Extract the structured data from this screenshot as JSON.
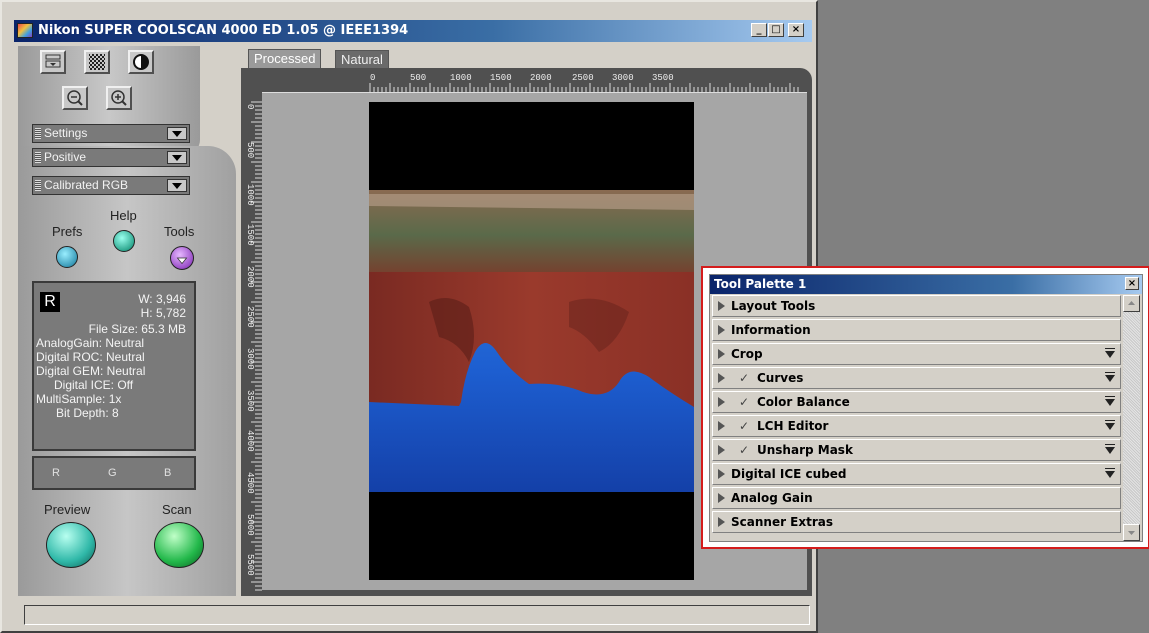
{
  "window": {
    "title": "Nikon SUPER COOLSCAN 4000 ED 1.05 @ IEEE1394",
    "minimize": "_",
    "maximize": "□",
    "close": "×"
  },
  "left_panel": {
    "dropdowns": [
      {
        "selected": "Settings"
      },
      {
        "selected": "Positive"
      },
      {
        "selected": "Calibrated RGB"
      }
    ],
    "buttons": {
      "prefs": "Prefs",
      "help": "Help",
      "tools": "Tools",
      "preview": "Preview",
      "scan": "Scan"
    },
    "info": {
      "channel_badge": "R",
      "width": "W: 3,946",
      "height": "H: 5,782",
      "file_size": "File Size: 65.3 MB",
      "analog_gain": "AnalogGain: Neutral",
      "digital_roc": "Digital ROC: Neutral",
      "digital_gem": "Digital GEM: Neutral",
      "digital_ice": "Digital ICE: Off",
      "multisample": "MultiSample: 1x",
      "bit_depth": "Bit Depth: 8"
    },
    "rgb_readout": {
      "r": "R",
      "g": "G",
      "b": "B"
    }
  },
  "preview": {
    "tabs": [
      {
        "label": "Processed",
        "active": true
      },
      {
        "label": "Natural",
        "active": false
      }
    ],
    "h_ruler": [
      "0",
      "500",
      "1000",
      "1500",
      "2000",
      "2500",
      "3000",
      "3500"
    ],
    "v_ruler": [
      "0",
      "500",
      "1000",
      "1500",
      "2000",
      "2500",
      "3000",
      "3500",
      "4000",
      "4500",
      "5000",
      "5500"
    ]
  },
  "tool_palette": {
    "title": "Tool Palette 1",
    "close": "×",
    "items": [
      {
        "label": "Layout Tools",
        "checked": false,
        "has_menu": false
      },
      {
        "label": "Information",
        "checked": false,
        "has_menu": false
      },
      {
        "label": "Crop",
        "checked": false,
        "has_menu": true
      },
      {
        "label": "Curves",
        "checked": true,
        "has_menu": true
      },
      {
        "label": "Color Balance",
        "checked": true,
        "has_menu": true
      },
      {
        "label": "LCH Editor",
        "checked": true,
        "has_menu": true
      },
      {
        "label": "Unsharp Mask",
        "checked": true,
        "has_menu": true
      },
      {
        "label": "Digital ICE cubed",
        "checked": false,
        "has_menu": true
      },
      {
        "label": "Analog Gain",
        "checked": false,
        "has_menu": false
      },
      {
        "label": "Scanner Extras",
        "checked": false,
        "has_menu": false
      }
    ],
    "check_glyph": "✓"
  },
  "colors": {
    "title_active": "#0a246a",
    "palette_highlight": "#d41c1c",
    "preview_teal": "#2fb8a8",
    "scan_green": "#22b84a",
    "tools_purple": "#9a4ec8"
  }
}
